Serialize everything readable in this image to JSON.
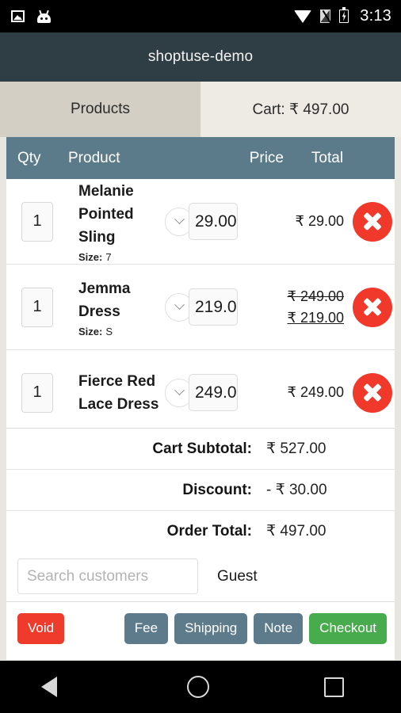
{
  "status_bar": {
    "icons": [
      "screenshot-icon",
      "android-robot-icon",
      "wifi-icon",
      "sim-missing-icon",
      "battery-charging-icon"
    ],
    "time": "3:13"
  },
  "app_bar": {
    "title": "shoptuse-demo"
  },
  "tabs": [
    {
      "label": "Products",
      "active": true
    },
    {
      "label": "Cart: ₹ 497.00",
      "active": false
    }
  ],
  "cart_table": {
    "columns": [
      "Qty",
      "Product",
      "Price",
      "Total"
    ],
    "rows": [
      {
        "qty": "1",
        "name": "Melanie Pointed Sling",
        "meta_label": "Size:",
        "meta_value": "7",
        "price_input": "29.00",
        "total": "₹ 29.00",
        "total_old": "",
        "total_new": ""
      },
      {
        "qty": "1",
        "name": "Jemma Dress",
        "meta_label": "Size:",
        "meta_value": "S",
        "price_input": "219.0",
        "total": "",
        "total_old": "₹ 249.00",
        "total_new": "₹ 219.00"
      },
      {
        "qty": "1",
        "name": "Fierce Red Lace Dress",
        "meta_label": "",
        "meta_value": "",
        "price_input": "249.0",
        "total": "₹ 249.00",
        "total_old": "",
        "total_new": ""
      }
    ]
  },
  "totals": [
    {
      "label": "Cart Subtotal:",
      "value": "₹ 527.00"
    },
    {
      "label": "Discount:",
      "value": "- ₹ 30.00"
    },
    {
      "label": "Order Total:",
      "value": "₹ 497.00"
    }
  ],
  "customer": {
    "search_placeholder": "Search customers",
    "search_value": "",
    "name": "Guest"
  },
  "actions": {
    "void": "Void",
    "fee": "Fee",
    "shipping": "Shipping",
    "note": "Note",
    "checkout": "Checkout"
  },
  "nav_bar": {
    "items": [
      "back-icon",
      "home-icon",
      "recents-icon"
    ]
  },
  "colors": {
    "app_bar": "#2f3d44",
    "tab_active": "#d4cfc5",
    "tab_inactive": "#eeebe5",
    "table_head": "#5c7b8a",
    "delete": "#f0392b",
    "void": "#ee3b2c",
    "slate": "#5d7b8a",
    "checkout": "#48ab4e",
    "page_bg": "#e8e6e0"
  }
}
